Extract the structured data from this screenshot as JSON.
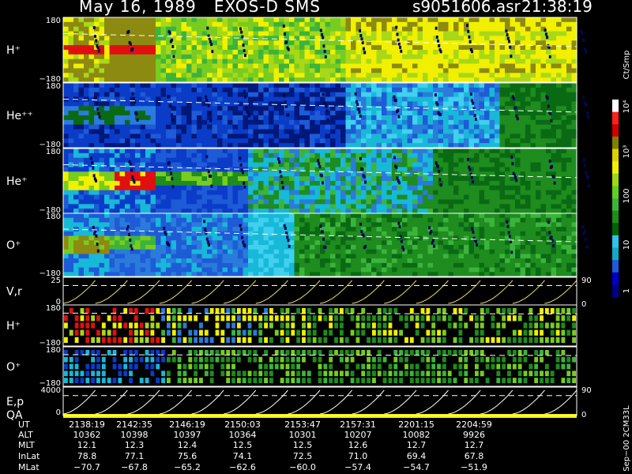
{
  "header": {
    "title": "May 16, 1989   EXOS-D SMS",
    "file": "s9051606.asr",
    "time": "21:38:19"
  },
  "colorbar": {
    "unit": "Ct/Smp",
    "ticks": [
      "1",
      "10",
      "100",
      "10³",
      "10⁴"
    ],
    "colors": [
      "#00008b",
      "#0000cd",
      "#1e5bd6",
      "#12a8c8",
      "#2ec4e8",
      "#006400",
      "#1e8c1e",
      "#3cb43c",
      "#60d020",
      "#a0d818",
      "#f0f000",
      "#e0d000",
      "#808000",
      "#d00000",
      "#ff2020",
      "#ffffff"
    ]
  },
  "panels": [
    {
      "label": "H⁺",
      "ytop": "180",
      "ybot": "−180"
    },
    {
      "label": "He⁺⁺",
      "ytop": "180",
      "ybot": "−180"
    },
    {
      "label": "He⁺",
      "ytop": "180",
      "ybot": "−180"
    },
    {
      "label": "O⁺",
      "ytop": "180",
      "ybot": "−180"
    },
    {
      "label": "V,r",
      "ytop": "25",
      "ybot": "0",
      "right_top": "90",
      "right_bot": "0"
    },
    {
      "label": "H⁺",
      "ytop": "180",
      "ybot": "−180"
    },
    {
      "label": "O⁺",
      "ytop": "180",
      "ybot": "−180"
    },
    {
      "label": "E,p",
      "ytop": "4000",
      "ybot": "0",
      "right_top": "90",
      "right_bot": "0",
      "label2": "QA"
    }
  ],
  "table": {
    "labels": [
      "UT",
      "ALT",
      "MLT",
      "InLat",
      "MLat"
    ],
    "columns": [
      {
        "UT": "2138:19",
        "ALT": "10362",
        "MLT": "12.1",
        "InLat": "78.8",
        "MLat": "−70.7"
      },
      {
        "UT": "2142:35",
        "ALT": "10398",
        "MLT": "12.3",
        "InLat": "77.1",
        "MLat": "−67.8"
      },
      {
        "UT": "2146:19",
        "ALT": "10397",
        "MLT": "12.4",
        "InLat": "75.6",
        "MLat": "−65.2"
      },
      {
        "UT": "2150:03",
        "ALT": "10364",
        "MLT": "12.5",
        "InLat": "74.1",
        "MLat": "−62.6"
      },
      {
        "UT": "2153:47",
        "ALT": "10301",
        "MLT": "12.5",
        "InLat": "72.5",
        "MLat": "−60.0"
      },
      {
        "UT": "2157:31",
        "ALT": "10207",
        "MLT": "12.6",
        "InLat": "71.0",
        "MLat": "−57.4"
      },
      {
        "UT": "2201:15",
        "ALT": "10082",
        "MLT": "12.7",
        "InLat": "69.4",
        "MLat": "−54.7"
      },
      {
        "UT": "2204:59",
        "ALT": "9926",
        "MLT": "12.7",
        "InLat": "67.8",
        "MLat": "−51.9"
      }
    ]
  },
  "footer": {
    "stamp": "Sep−00 2CM33L"
  },
  "chart_data": {
    "type": "heatmap",
    "title": "May 16, 1989   EXOS-D SMS",
    "x": [
      "2138:19",
      "2142:35",
      "2146:19",
      "2150:03",
      "2153:47",
      "2157:31",
      "2201:15",
      "2204:59"
    ],
    "series": [
      {
        "name": "H⁺",
        "ylim": [
          -180,
          180
        ]
      },
      {
        "name": "He⁺⁺",
        "ylim": [
          -180,
          180
        ]
      },
      {
        "name": "He⁺",
        "ylim": [
          -180,
          180
        ]
      },
      {
        "name": "O⁺",
        "ylim": [
          -180,
          180
        ]
      },
      {
        "name": "V,r",
        "ylim": [
          0,
          25
        ],
        "ylim_right": [
          0,
          90
        ]
      },
      {
        "name": "H⁺",
        "ylim": [
          -180,
          180
        ]
      },
      {
        "name": "O⁺",
        "ylim": [
          -180,
          180
        ]
      },
      {
        "name": "E,p",
        "ylim": [
          0,
          4000
        ],
        "ylim_right": [
          0,
          90
        ]
      }
    ],
    "colorbar_ticks": [
      "1",
      "10",
      "100",
      "10³",
      "10⁴"
    ],
    "grid": false
  }
}
